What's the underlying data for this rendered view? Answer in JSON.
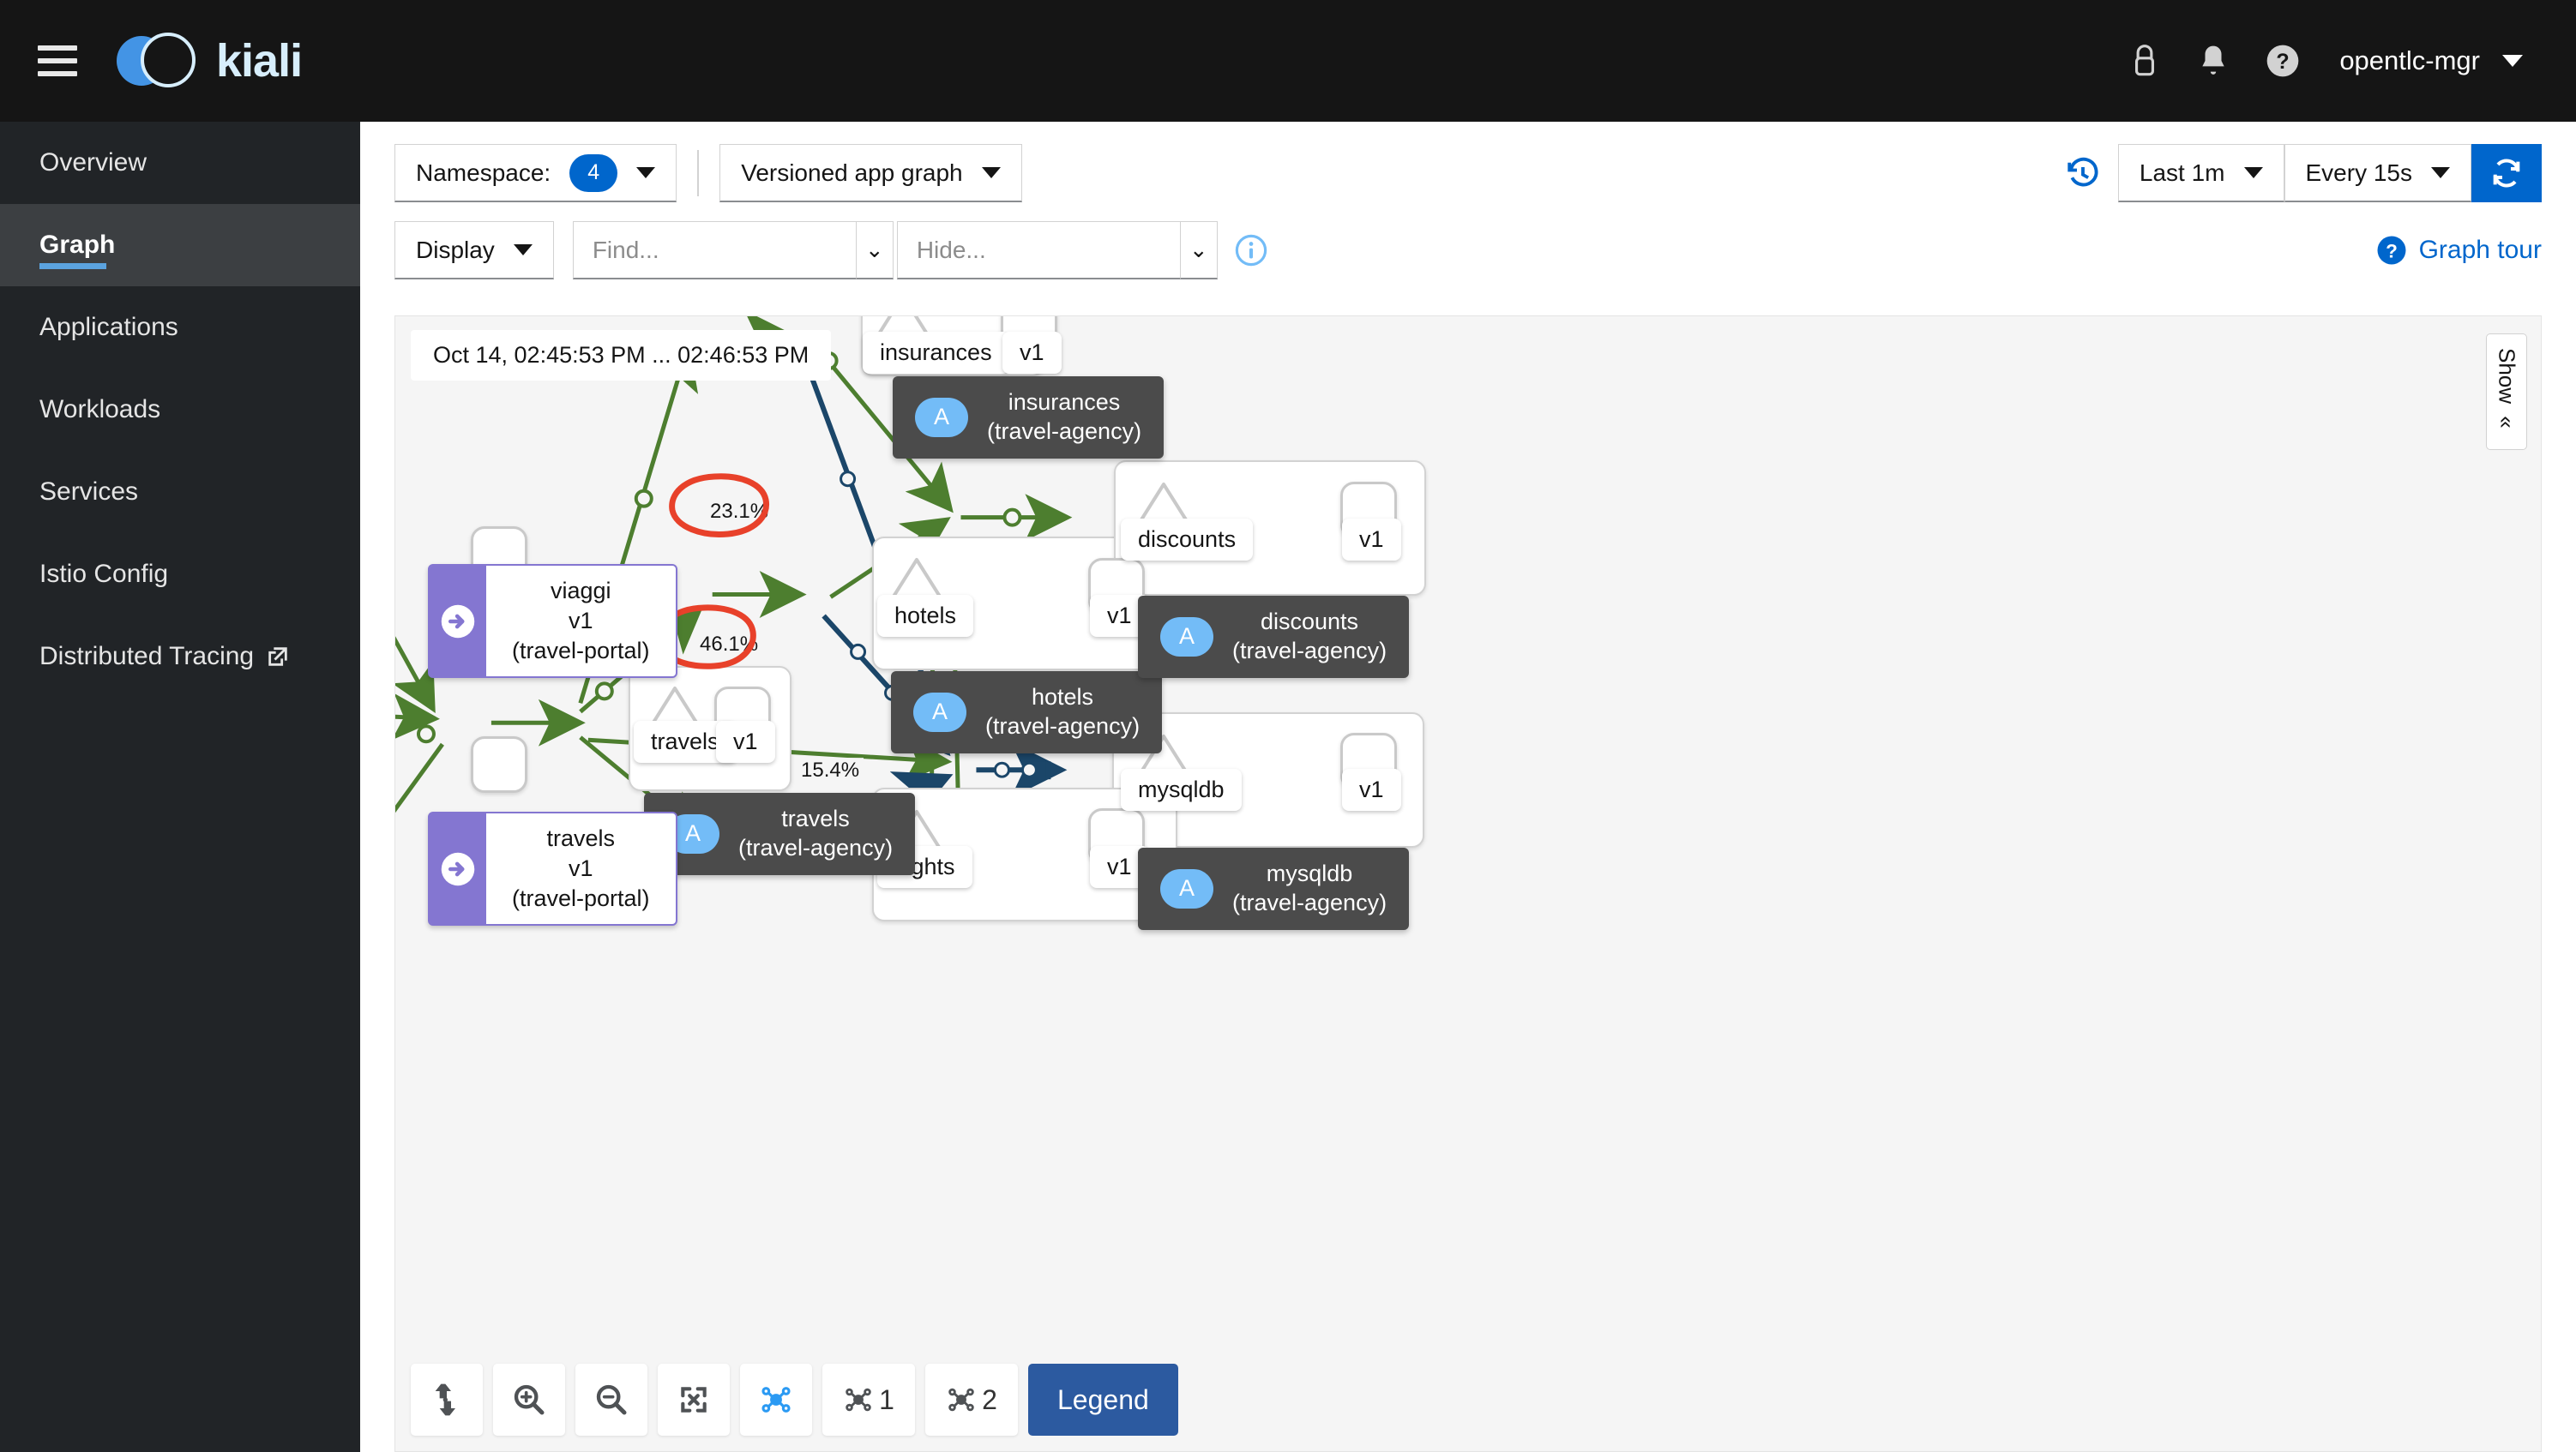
{
  "masthead": {
    "brand_name": "kiali",
    "menu_icon": "hamburger-icon",
    "icons": [
      "lock-icon",
      "bell-icon",
      "help-icon"
    ],
    "user": "opentlc-mgr"
  },
  "sidebar": {
    "items": [
      {
        "label": "Overview",
        "active": false,
        "external": false
      },
      {
        "label": "Graph",
        "active": true,
        "external": false
      },
      {
        "label": "Applications",
        "active": false,
        "external": false
      },
      {
        "label": "Workloads",
        "active": false,
        "external": false
      },
      {
        "label": "Services",
        "active": false,
        "external": false
      },
      {
        "label": "Istio Config",
        "active": false,
        "external": false
      },
      {
        "label": "Distributed Tracing",
        "active": false,
        "external": true
      }
    ]
  },
  "toolbar": {
    "namespace_label": "Namespace:",
    "namespace_count": "4",
    "graph_type": "Versioned app graph",
    "display_label": "Display",
    "find_placeholder": "Find...",
    "hide_placeholder": "Hide...",
    "find_value": "",
    "hide_value": "",
    "time_range": "Last 1m",
    "refresh_interval": "Every 15s",
    "refresh_icon": "refresh-icon",
    "replay_icon": "history-icon",
    "info_icon": "info-circle-icon",
    "graph_tour": "Graph tour"
  },
  "graph": {
    "timestamp": "Oct 14, 02:45:53 PM ... 02:46:53 PM",
    "version_label": "v1",
    "groups": [
      {
        "id": "insurances",
        "service": "insurances",
        "version": "v1",
        "tooltip": "insurances",
        "namespace": "(travel-agency)",
        "badge": "A"
      },
      {
        "id": "hotels",
        "service": "hotels",
        "version": "v1",
        "tooltip": "hotels",
        "namespace": "(travel-agency)",
        "badge": "A"
      },
      {
        "id": "discounts",
        "service": "discounts",
        "version": "v1",
        "tooltip": "discounts",
        "namespace": "(travel-agency)",
        "badge": "A"
      },
      {
        "id": "travels",
        "service": "travels",
        "version": "v1",
        "tooltip": "travels",
        "namespace": "(travel-agency)",
        "badge": "A"
      },
      {
        "id": "mysqldb",
        "service": "mysqldb",
        "version": "v1",
        "tooltip": "mysqldb",
        "namespace": "(travel-agency)",
        "badge": "A"
      },
      {
        "id": "flights",
        "service": "flights",
        "version": "v1",
        "tooltip": "flights",
        "namespace": "(travel-agency)",
        "badge": "A"
      }
    ],
    "sources": [
      {
        "id": "viaggi",
        "name": "viaggi",
        "version": "v1",
        "namespace": "(travel-portal)"
      },
      {
        "id": "travels-portal",
        "name": "travels",
        "version": "v1",
        "namespace": "(travel-portal)"
      }
    ],
    "edge_labels": [
      {
        "id": "e1",
        "value": "23.1%",
        "highlighted": true
      },
      {
        "id": "e2",
        "value": "46.1%",
        "highlighted": true
      },
      {
        "id": "e3",
        "value": "15.4%",
        "highlighted": false
      }
    ],
    "colors": {
      "http": "#4d7e2f",
      "tcp": "#1b4669",
      "annotation": "#e8412a",
      "purple": "#8476d1"
    }
  },
  "graph_tools": {
    "buttons": [
      {
        "name": "drag-pan",
        "label": ""
      },
      {
        "name": "zoom-in",
        "label": ""
      },
      {
        "name": "zoom-out",
        "label": ""
      },
      {
        "name": "fit-to-screen",
        "label": ""
      },
      {
        "name": "layout-default",
        "label": ""
      },
      {
        "name": "layout-1",
        "label": "1"
      },
      {
        "name": "layout-2",
        "label": "2"
      }
    ],
    "legend": "Legend"
  },
  "side_panel": {
    "toggle_label": "Show",
    "chevron": "«"
  }
}
